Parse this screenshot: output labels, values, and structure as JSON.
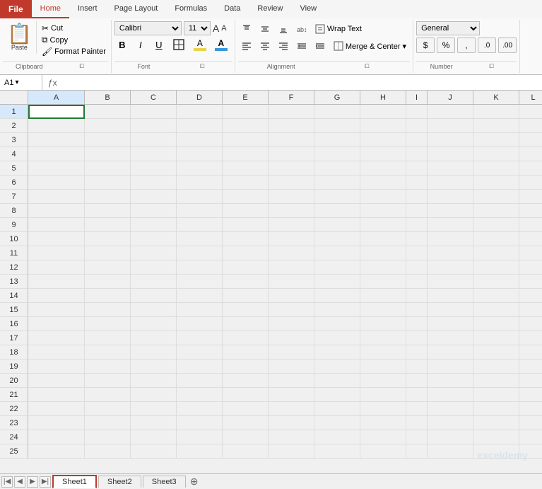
{
  "ribbon": {
    "tabs": [
      "File",
      "Home",
      "Insert",
      "Page Layout",
      "Formulas",
      "Data",
      "Review",
      "View"
    ],
    "active_tab": "Home"
  },
  "clipboard": {
    "group_label": "Clipboard",
    "paste_label": "Paste",
    "cut_label": "Cut",
    "copy_label": "Copy",
    "format_painter_label": "Format Painter"
  },
  "font": {
    "group_label": "Font",
    "font_name": "Calibri",
    "font_size": "11",
    "bold_label": "B",
    "italic_label": "I",
    "underline_label": "U"
  },
  "alignment": {
    "group_label": "Alignment",
    "wrap_text": "Wrap Text",
    "merge_center": "Merge & Center ▾"
  },
  "number": {
    "group_label": "Number",
    "format": "General"
  },
  "formula_bar": {
    "cell_ref": "A1",
    "formula": ""
  },
  "columns": [
    "A",
    "B",
    "C",
    "D",
    "E",
    "F",
    "G",
    "H",
    "I",
    "J",
    "K",
    "L"
  ],
  "rows": [
    1,
    2,
    3,
    4,
    5,
    6,
    7,
    8,
    9,
    10,
    11,
    12,
    13,
    14,
    15,
    16,
    17,
    18,
    19,
    20,
    21,
    22,
    23,
    24,
    25
  ],
  "sheets": {
    "active": "Sheet1",
    "tabs": [
      "Sheet1",
      "Sheet2",
      "Sheet3"
    ]
  },
  "watermark": "exceldemy"
}
